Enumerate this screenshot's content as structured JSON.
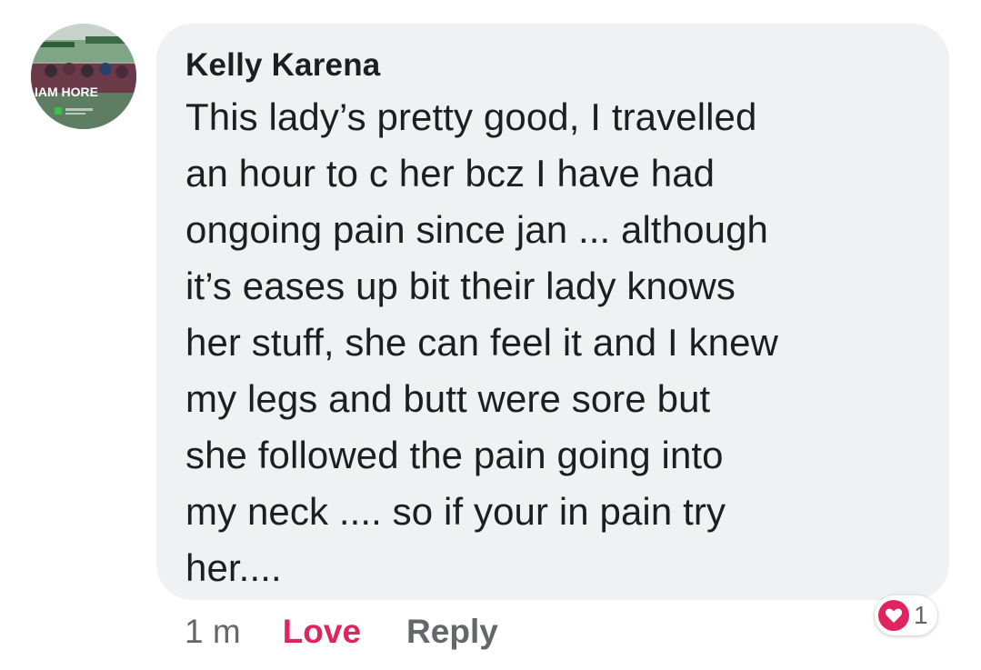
{
  "comment": {
    "author": "Kelly Karena",
    "text": "This lady’s pretty good, I travelled\nan hour to c her bcz I have had\nongoing pain since jan ... although\nit’s eases up bit their lady knows\nher stuff, she can feel it and I knew\nmy legs and butt were sore but\nshe followed the pain going into\nmy neck .... so if your in pain try\nher....",
    "avatar_text": "IAM HORE",
    "avatar_icon": "profile-avatar"
  },
  "actions": {
    "timestamp": "1 m",
    "love_label": "Love",
    "reply_label": "Reply"
  },
  "reactions": {
    "icon": "heart-icon",
    "count": "1"
  },
  "colors": {
    "bubble": "#eff1f3",
    "love": "#e0245e",
    "muted": "#65676b",
    "text": "#1c1e21"
  }
}
